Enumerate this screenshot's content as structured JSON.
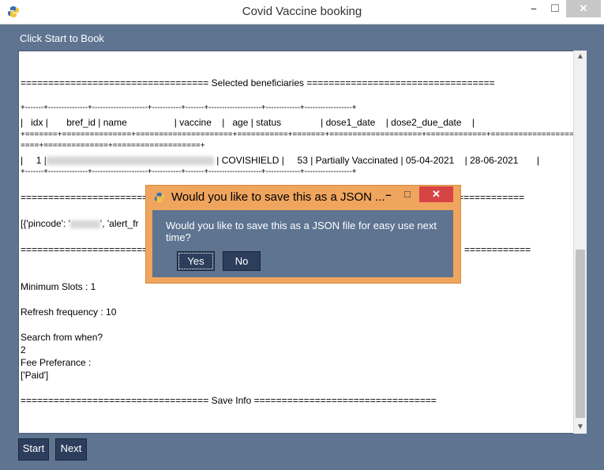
{
  "window": {
    "title": "Covid Vaccine booking",
    "minimize": "–",
    "maximize": "☐",
    "close": "✕"
  },
  "header": {
    "label": "Click Start to Book"
  },
  "log": {
    "beneficiaries_header": "================================== Selected beneficiaries ==================================",
    "table_border_top": "+-------+---------------+---------------------+-----------+-------+--------------------+-------------+------------------+",
    "table_header": "|   idx |       bref_id | name                  | vaccine    |   age | status               | dose1_date    | dose2_due_date    |",
    "table_border_mid": "+=======+===============+=====================+===========+=======+====================+=============+==================+",
    "table_border_mid2": "====+==============+===================+",
    "row_prefix": "|     1 |",
    "row_suffix": " | COVISHIELD |     53 | Partially Vaccinated | 05-04-2021    | 28-06-2021       |",
    "table_border_bottom": "+-------+---------------+---------------------+-----------+-------+--------------------+-------------+------------------+",
    "sep_line_1": "================================",
    "sep_line_1_right": "============",
    "info_prefix": "[{'pincode': '",
    "info_middle": "', 'alert_fr",
    "sep_line_2": "================================",
    "sep_line_2_right": "============",
    "min_slots": "Minimum Slots : 1",
    "refresh": "Refresh frequency : 10",
    "search_when": "Search from when?",
    "search_value": "2",
    "fee_label": "Fee Preferance :",
    "fee_value": "['Paid']",
    "save_info": "================================== Save Info ================================="
  },
  "buttons": {
    "start": "Start",
    "next": "Next"
  },
  "dialog": {
    "title": "Would you like to save this as a JSON ...",
    "message": "Would you like to save this as a JSON file for easy use next time?",
    "yes": "Yes",
    "no": "No",
    "minimize": "–",
    "maximize": "☐",
    "close": "✕"
  },
  "colors": {
    "frame": "#5e7491",
    "button": "#2c3e5c",
    "dialog_border": "#f0a55e",
    "dialog_close": "#d64444"
  }
}
